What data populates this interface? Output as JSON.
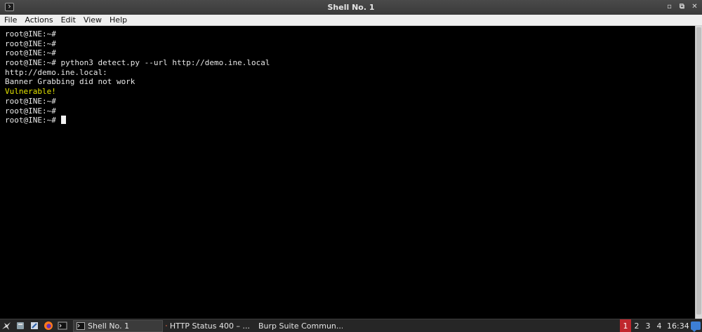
{
  "window": {
    "title": "Shell No. 1"
  },
  "menu": [
    "File",
    "Actions",
    "Edit",
    "View",
    "Help"
  ],
  "terminal": {
    "lines": [
      {
        "text": "root@INE:~#",
        "color": "default"
      },
      {
        "text": "root@INE:~#",
        "color": "default"
      },
      {
        "text": "root@INE:~#",
        "color": "default"
      },
      {
        "text": "root@INE:~# python3 detect.py --url http://demo.ine.local",
        "color": "default"
      },
      {
        "text": "http://demo.ine.local:",
        "color": "default"
      },
      {
        "text": "Banner Grabbing did not work",
        "color": "default"
      },
      {
        "text": "Vulnerable!",
        "color": "yellow"
      },
      {
        "text": "root@INE:~#",
        "color": "default"
      },
      {
        "text": "root@INE:~#",
        "color": "default"
      },
      {
        "text": "root@INE:~# ",
        "color": "default",
        "cursor": true
      }
    ]
  },
  "taskbar": {
    "launchers": [
      "kali-menu-icon",
      "file-manager-icon",
      "text-editor-icon",
      "firefox-icon",
      "terminal-icon"
    ],
    "tasks": [
      {
        "label": "Shell No. 1",
        "icon": "terminal-icon",
        "active": true
      },
      {
        "label": "HTTP Status 400 – ...",
        "icon": "firefox-icon",
        "active": false
      },
      {
        "label": "Burp Suite Commun...",
        "icon": "burp-icon",
        "active": false
      }
    ],
    "workspaces": [
      "1",
      "2",
      "3",
      "4"
    ],
    "active_workspace": "1",
    "clock": "16:34"
  },
  "colors": {
    "terminal_bg": "#000000",
    "terminal_fg": "#e8e8e8",
    "highlight_yellow": "#e5e500",
    "workspace_active": "#c0272d"
  }
}
